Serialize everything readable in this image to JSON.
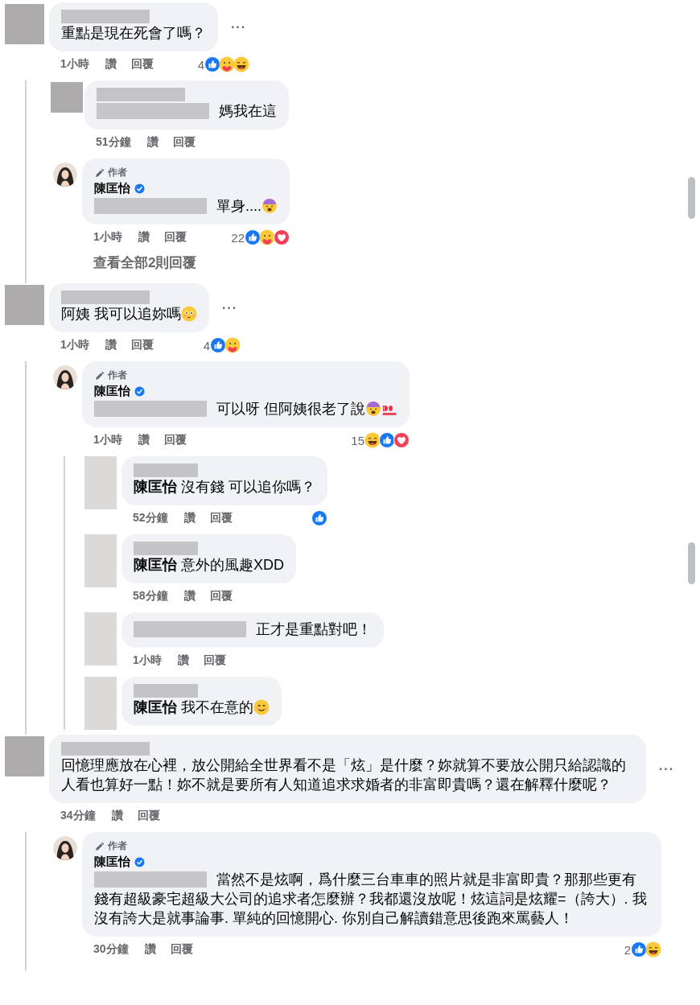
{
  "comments": [
    {
      "avatar": {
        "kind": "redacted"
      },
      "name_redacted": true,
      "text": "重點是現在死會了嗎？",
      "time": "1小時",
      "like": "讚",
      "reply": "回覆",
      "reaction_count": "4",
      "reactions": [
        {
          "kind": "like"
        },
        {
          "kind": "care"
        },
        {
          "kind": "haha"
        }
      ],
      "more": "···",
      "replies": [
        {
          "avatar": {
            "kind": "redacted"
          },
          "name_redacted": true,
          "mention_redacted": true,
          "text": "媽我在這",
          "time": "51分鐘",
          "like": "讚",
          "reply": "回覆"
        },
        {
          "avatar": {
            "kind": "photo"
          },
          "author_badge": "作者",
          "name": "陳匡怡",
          "verified": true,
          "mention_redacted": true,
          "text": "單身....",
          "emojis": [
            {
              "kind": "weary"
            }
          ],
          "time": "1小時",
          "like": "讚",
          "reply": "回覆",
          "reaction_count": "22",
          "reactions": [
            {
              "kind": "like"
            },
            {
              "kind": "care"
            },
            {
              "kind": "love"
            }
          ]
        }
      ],
      "view_replies": "查看全部2則回覆"
    },
    {
      "avatar": {
        "kind": "redacted"
      },
      "name_redacted": true,
      "text": "阿姨 我可以追妳嗎",
      "emojis": [
        {
          "kind": "flushed"
        }
      ],
      "time": "1小時",
      "like": "讚",
      "reply": "回覆",
      "reaction_count": "4",
      "reactions": [
        {
          "kind": "like"
        },
        {
          "kind": "care"
        }
      ],
      "more": "···",
      "replies": [
        {
          "avatar": {
            "kind": "photo"
          },
          "author_badge": "作者",
          "name": "陳匡怡",
          "verified": true,
          "mention_redacted": true,
          "text": "可以呀 但阿姨很老了說",
          "emojis": [
            {
              "kind": "weary"
            },
            {
              "kind": "hundred"
            }
          ],
          "time": "1小時",
          "like": "讚",
          "reply": "回覆",
          "reaction_count": "15",
          "reactions": [
            {
              "kind": "haha"
            },
            {
              "kind": "like"
            },
            {
              "kind": "love"
            }
          ],
          "replies": [
            {
              "avatar": {
                "kind": "redacted"
              },
              "name_redacted": true,
              "tag": "陳匡怡",
              "text": "沒有錢 可以追你嗎？",
              "time": "52分鐘",
              "like": "讚",
              "reply": "回覆",
              "reactions": [
                {
                  "kind": "like"
                }
              ]
            },
            {
              "avatar": {
                "kind": "redacted"
              },
              "name_redacted": true,
              "tag": "陳匡怡",
              "text": "意外的風趣XDD",
              "time": "58分鐘",
              "like": "讚",
              "reply": "回覆"
            },
            {
              "avatar": {
                "kind": "redacted"
              },
              "mention_redacted": true,
              "text": "正才是重點對吧！",
              "time": "1小時",
              "like": "讚",
              "reply": "回覆"
            },
            {
              "avatar": {
                "kind": "redacted"
              },
              "name_redacted": true,
              "tag": "陳匡怡",
              "text": "我不在意的",
              "emojis": [
                {
                  "kind": "smile"
                }
              ]
            }
          ]
        }
      ]
    },
    {
      "avatar": {
        "kind": "redacted"
      },
      "name_redacted": true,
      "text": "回憶理應放在心裡，放公開給全世界看不是「炫」是什麼？妳就算不要放公開只給認識的人看也算好一點！妳不就是要所有人知道追求求婚者的非富即貴嗎？還在解釋什麼呢？",
      "time": "34分鐘",
      "like": "讚",
      "reply": "回覆",
      "more": "···",
      "replies": [
        {
          "avatar": {
            "kind": "photo"
          },
          "author_badge": "作者",
          "name": "陳匡怡",
          "verified": true,
          "mention_redacted": true,
          "text": "當然不是炫啊，爲什麼三台車車的照片就是非富即貴？那那些更有錢有超級豪宅超級大公司的追求者怎麼辦？我都還沒放呢！炫這詞是炫耀=（誇大）. 我沒有誇大是就事論事. 單純的回憶開心. 你別自己解讀錯意思後跑來罵藝人！",
          "time": "30分鐘",
          "like": "讚",
          "reply": "回覆",
          "reaction_count": "2",
          "reactions": [
            {
              "kind": "like"
            },
            {
              "kind": "haha"
            }
          ]
        }
      ]
    }
  ]
}
